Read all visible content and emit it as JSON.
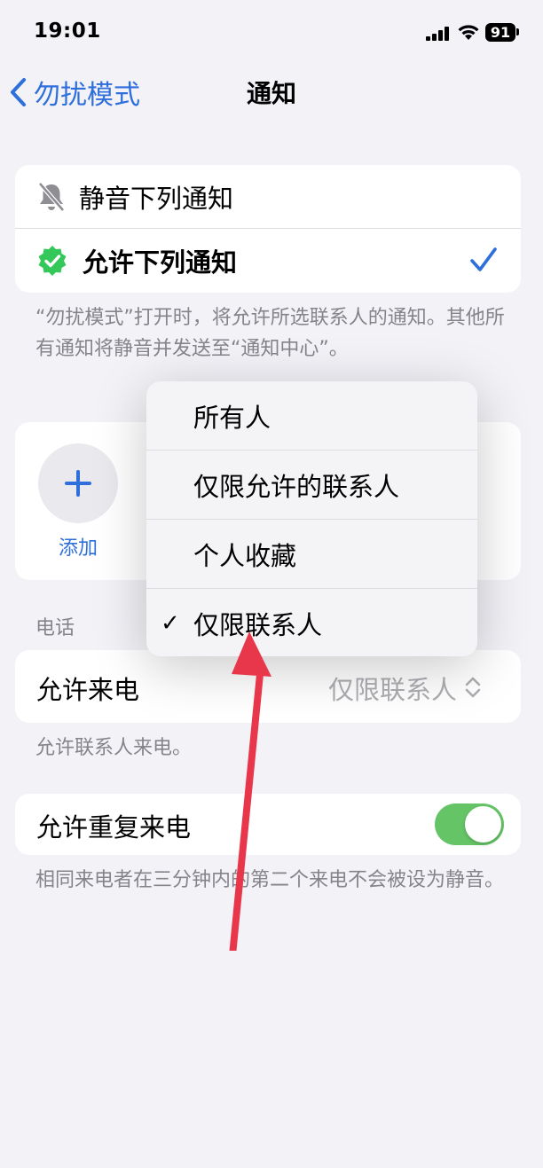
{
  "status_bar": {
    "time": "19:01",
    "battery": "91"
  },
  "nav": {
    "back_label": "勿扰模式",
    "title": "通知"
  },
  "mode_options": {
    "silence_label": "静音下列通知",
    "allow_label": "允许下列通知",
    "selected": "allow"
  },
  "mode_description": "“勿扰模式”打开时，将允许所选联系人的通知。其他所有通知将静音并发送至“通知中心”。",
  "people": {
    "add_label": "添加"
  },
  "calls_section": {
    "header": "电话",
    "allow_calls_label": "允许来电",
    "allow_calls_value": "仅限联系人",
    "allow_calls_footer": "允许联系人来电。",
    "repeat_calls_label": "允许重复来电",
    "repeat_calls_on": true,
    "repeat_calls_footer": "相同来电者在三分钟内的第二个来电不会被设为静音。"
  },
  "menu": {
    "items": [
      {
        "label": "所有人",
        "checked": false
      },
      {
        "label": "仅限允许的联系人",
        "checked": false
      },
      {
        "label": "个人收藏",
        "checked": false
      },
      {
        "label": "仅限联系人",
        "checked": true
      }
    ],
    "check_mark": "✓"
  },
  "colors": {
    "accent": "#2e6fdc",
    "toggle_on": "#65c466",
    "badge_green": "#34c759",
    "annotation_arrow": "#e8374a"
  }
}
